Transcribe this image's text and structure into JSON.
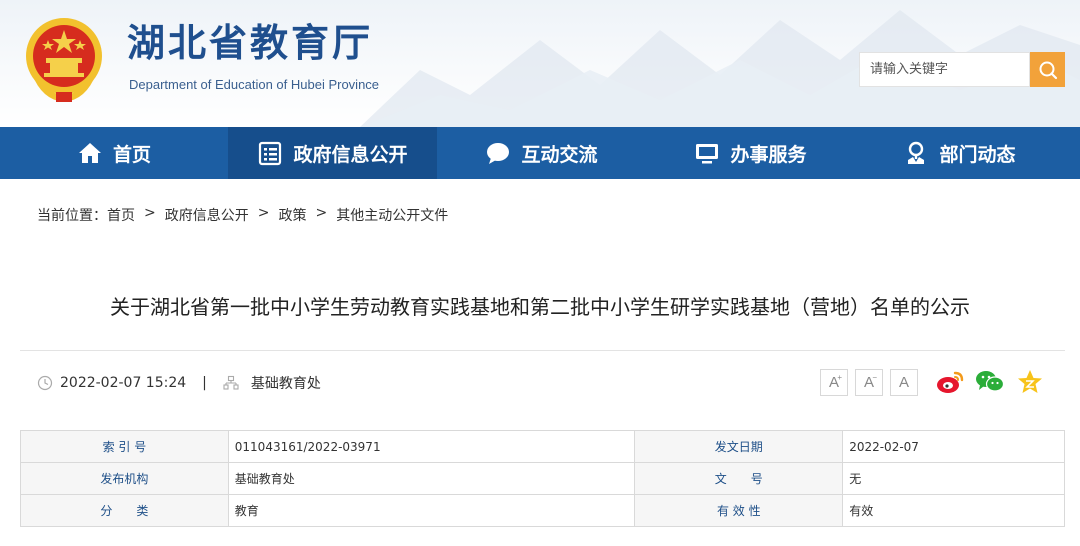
{
  "header": {
    "title": "湖北省教育厅",
    "subtitle": "Department of Education of Hubei Province",
    "search_placeholder": "请输入关键字",
    "search_icon": "search-icon"
  },
  "nav": {
    "items": [
      {
        "label": "首页",
        "icon": "home-icon"
      },
      {
        "label": "政府信息公开",
        "icon": "document-list-icon"
      },
      {
        "label": "互动交流",
        "icon": "chat-bubble-icon"
      },
      {
        "label": "办事服务",
        "icon": "monitor-icon"
      },
      {
        "label": "部门动态",
        "icon": "location-pin-icon"
      }
    ],
    "active_index": 1
  },
  "breadcrumb": {
    "prefix": "当前位置：",
    "items": [
      "首页",
      "政府信息公开",
      "政策",
      "其他主动公开文件"
    ],
    "separator": ">"
  },
  "article": {
    "title": "关于湖北省第一批中小学生劳动教育实践基地和第二批中小学生研学实践基地（营地）名单的公示",
    "datetime": "2022-02-07 15:24",
    "divider": "|",
    "source": "基础教育处"
  },
  "tools": {
    "font_buttons": [
      "A",
      "A",
      "A"
    ],
    "share_icons": [
      "weibo-icon",
      "wechat-icon",
      "favorite-star-icon"
    ]
  },
  "meta": {
    "rows": [
      {
        "label1": "索 引 号",
        "value1": "011043161/2022-03971",
        "label2": "发文日期",
        "value2": "2022-02-07"
      },
      {
        "label1": "发布机构",
        "value1": "基础教育处",
        "label2": "文　　号",
        "value2": "无"
      },
      {
        "label1": "分　　类",
        "value1": "教育",
        "label2": "有 效 性",
        "value2": "有效"
      }
    ]
  },
  "colors": {
    "nav_bg": "#1c5ea3",
    "nav_active": "#164e8c",
    "search_button": "#f2a23a",
    "title_blue": "#1f4f8e"
  }
}
